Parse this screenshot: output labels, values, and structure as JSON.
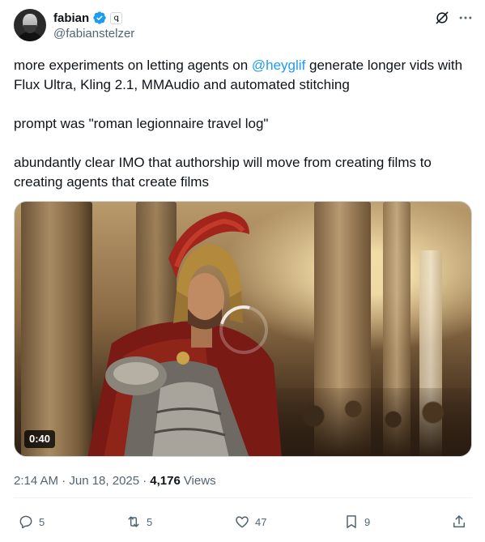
{
  "author": {
    "display_name": "fabian",
    "handle": "@fabianstelzer",
    "affiliate_badge": "ꝗ",
    "verified_color": "#1d9bf0"
  },
  "header_icons": [
    "grok-icon",
    "more-icon"
  ],
  "tweet": {
    "line1_before": "more experiments on letting agents on ",
    "mention": "@heyglif",
    "line1_after": " generate longer vids with Flux Ultra, Kling 2.1, MMAudio and automated stitching",
    "paragraph2": "prompt was \"roman legionnaire travel log\"",
    "paragraph3": "abundantly clear IMO that authorship will move from creating films to creating agents that create films"
  },
  "media": {
    "duration": "0:40"
  },
  "meta": {
    "time": "2:14 AM · Jun 18, 2025 ·",
    "views_count": "4,176",
    "views_label": "Views"
  },
  "actions": {
    "replies": "5",
    "reposts": "5",
    "likes": "47",
    "bookmarks": "9"
  },
  "colors": {
    "accent": "#1d9bf0",
    "secondary_text": "#536471",
    "primary_text": "#0f1419"
  }
}
